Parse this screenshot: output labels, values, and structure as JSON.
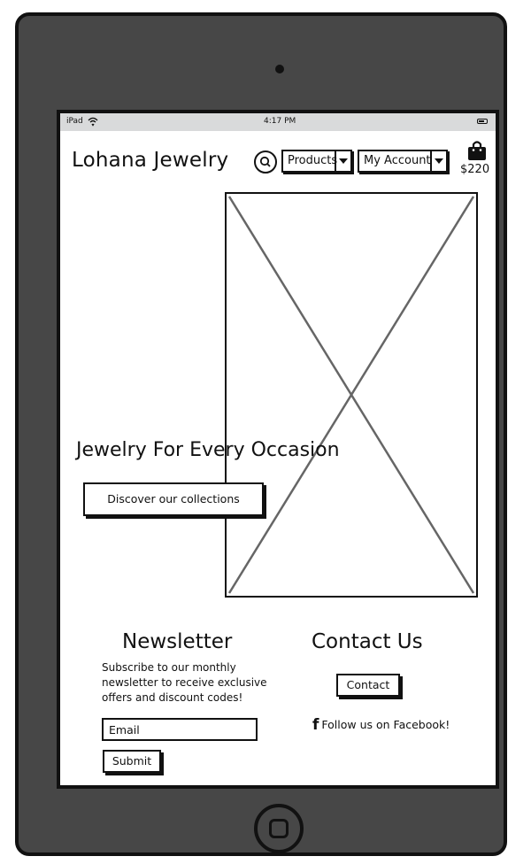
{
  "status_bar": {
    "carrier": "iPad",
    "time": "4:17 PM"
  },
  "header": {
    "logo": "Lohana Jewelry",
    "products_dropdown": "Products",
    "account_dropdown": "My Account",
    "cart_total": "$220"
  },
  "hero": {
    "title": "Jewelry For Every Occasion",
    "button_label": "Discover our collections"
  },
  "newsletter": {
    "title": "Newsletter",
    "description": "Subscribe to our monthly newsletter to receive exclusive offers and discount codes!",
    "email_placeholder": "Email",
    "submit_label": "Submit"
  },
  "contact": {
    "title": "Contact Us",
    "button_label": "Contact",
    "facebook_icon": "f",
    "facebook_label": "Follow us on Facebook!"
  },
  "icons": [
    "wifi-icon",
    "battery-icon",
    "search-icon",
    "chevron-down-icon",
    "shopping-bag-icon",
    "facebook-icon",
    "camera-icon",
    "home-button-icon"
  ],
  "colors": {
    "device_frame": "#474747",
    "status_bar": "#d9dadb",
    "ink": "#111111",
    "placeholder_cross": "#666666"
  }
}
